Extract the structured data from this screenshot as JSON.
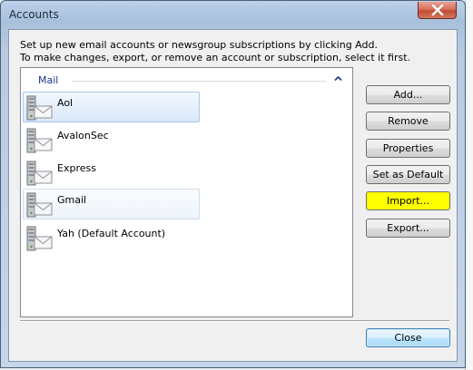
{
  "window": {
    "title": "Accounts"
  },
  "description": {
    "line1": "Set up new email accounts or newsgroup subscriptions by clicking Add.",
    "line2": "To make changes, export, or remove an account or subscription, select it first."
  },
  "account_list": {
    "group_label": "Mail",
    "accounts": [
      {
        "name": "Aol",
        "state": "selected"
      },
      {
        "name": "AvalonSec",
        "state": "normal"
      },
      {
        "name": "Express",
        "state": "normal"
      },
      {
        "name": "Gmail",
        "state": "hover"
      },
      {
        "name": "Yah (Default Account)",
        "state": "normal"
      }
    ]
  },
  "buttons": {
    "add": "Add...",
    "remove": "Remove",
    "properties": "Properties",
    "set_default": "Set as Default",
    "import": "Import...",
    "export": "Export...",
    "close": "Close"
  },
  "colors": {
    "highlight": "#ffff00",
    "group_label": "#1e3287",
    "selection": "#dae8fa"
  }
}
